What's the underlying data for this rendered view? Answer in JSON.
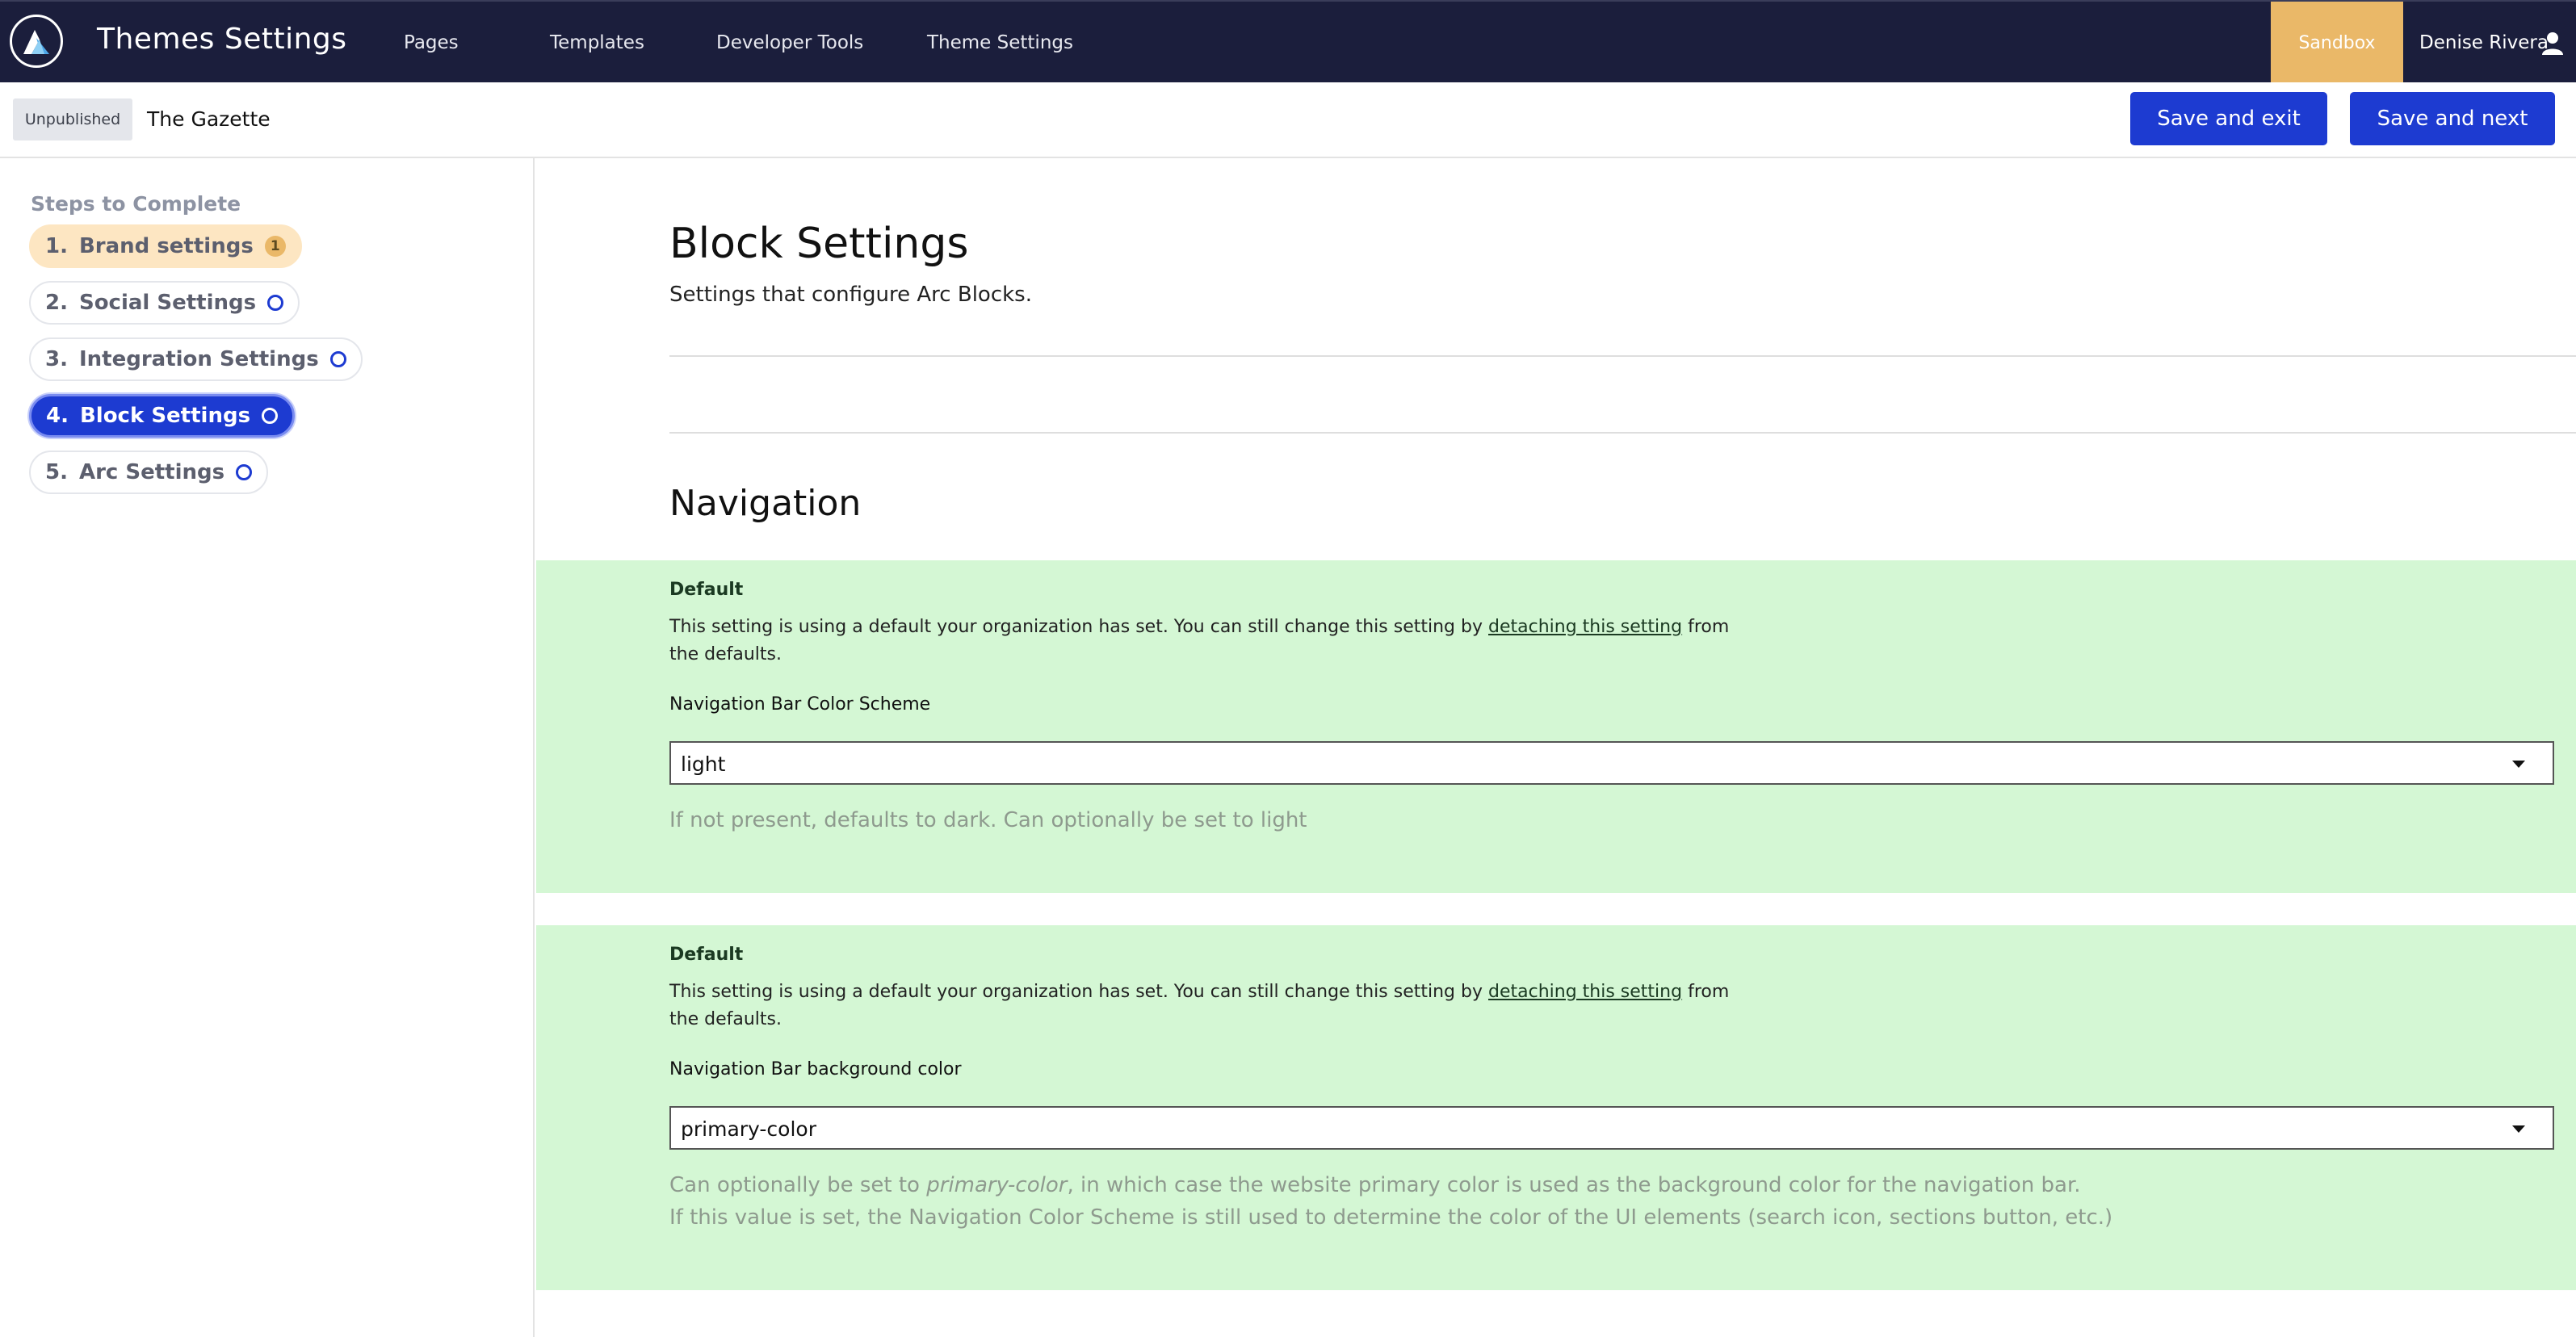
{
  "header": {
    "title": "Themes Settings",
    "nav": [
      "Pages",
      "Templates",
      "Developer Tools",
      "Theme Settings"
    ],
    "environment": "Sandbox",
    "user": "Denise Rivera",
    "icons": {
      "logo": "arc-logo-icon",
      "user": "user-icon"
    },
    "colors": {
      "bar": "#1b1e3c",
      "sandbox": "#eab868"
    }
  },
  "subheader": {
    "status": "Unpublished",
    "site": "The Gazette",
    "save_exit": "Save and exit",
    "save_next": "Save and next",
    "button_color": "#1d3bd1"
  },
  "sidebar": {
    "title": "Steps to Complete",
    "steps": [
      {
        "num": "1.",
        "label": "Brand settings",
        "badge": "1",
        "state": "warning"
      },
      {
        "num": "2.",
        "label": "Social Settings",
        "state": "incomplete"
      },
      {
        "num": "3.",
        "label": "Integration Settings",
        "state": "incomplete"
      },
      {
        "num": "4.",
        "label": "Block Settings",
        "state": "active"
      },
      {
        "num": "5.",
        "label": "Arc Settings",
        "state": "incomplete"
      }
    ]
  },
  "main": {
    "title": "Block Settings",
    "description": "Settings that configure Arc Blocks.",
    "section": "Navigation",
    "settings": [
      {
        "default_label": "Default",
        "notice_before": "This setting is using a default your organization has set. You can still change this setting by ",
        "notice_link": "detaching this setting",
        "notice_after": " from the defaults.",
        "label": "Navigation Bar Color Scheme",
        "value": "light",
        "help": "If not present, defaults to dark. Can optionally be set to light"
      },
      {
        "default_label": "Default",
        "notice_before": "This setting is using a default your organization has set. You can still change this setting by ",
        "notice_link": "detaching this setting",
        "notice_after": " from the defaults.",
        "label": "Navigation Bar background color",
        "value": "primary-color",
        "help_before": "Can optionally be set to ",
        "help_em": "primary-color",
        "help_after": ", in which case the website primary color is used as the background color for the navigation bar.",
        "help_line2": "If this value is set, the Navigation Color Scheme is still used to determine the color of the UI elements (search icon, sections button, etc.)"
      }
    ],
    "panel_color": "#d4f7d4"
  }
}
